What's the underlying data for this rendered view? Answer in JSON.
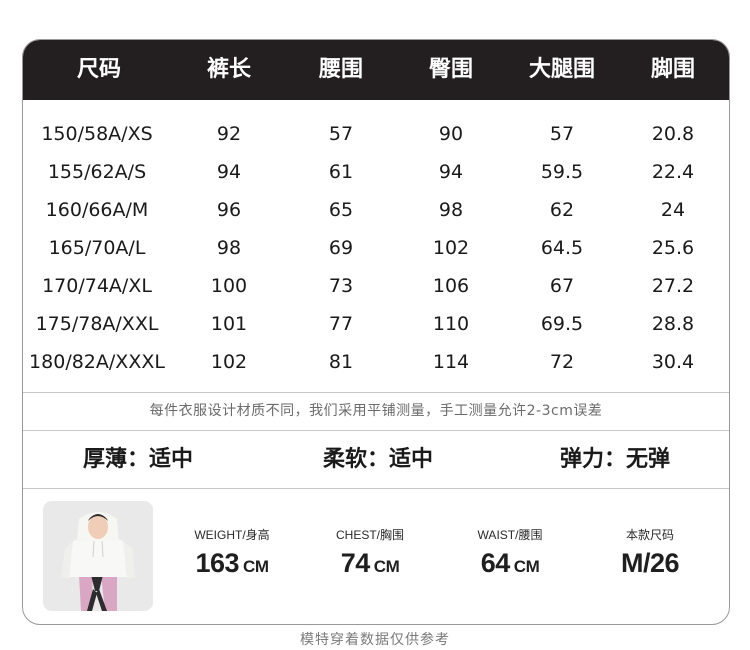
{
  "table": {
    "headers": [
      "尺码",
      "裤长",
      "腰围",
      "臀围",
      "大腿围",
      "脚围"
    ],
    "rows": [
      [
        "150/58A/XS",
        "92",
        "57",
        "90",
        "57",
        "20.8"
      ],
      [
        "155/62A/S",
        "94",
        "61",
        "94",
        "59.5",
        "22.4"
      ],
      [
        "160/66A/M",
        "96",
        "65",
        "98",
        "62",
        "24"
      ],
      [
        "165/70A/L",
        "98",
        "69",
        "102",
        "64.5",
        "25.6"
      ],
      [
        "170/74A/XL",
        "100",
        "73",
        "106",
        "67",
        "27.2"
      ],
      [
        "175/78A/XXL",
        "101",
        "77",
        "110",
        "69.5",
        "28.8"
      ],
      [
        "180/82A/XXXL",
        "102",
        "81",
        "114",
        "72",
        "30.4"
      ]
    ]
  },
  "note": "每件衣服设计材质不同，我们采用平铺测量，手工测量允许2-3cm误差",
  "features": [
    {
      "label": "厚薄：适中"
    },
    {
      "label": "柔软：适中"
    },
    {
      "label": "弹力：无弹"
    }
  ],
  "model": {
    "stats": [
      {
        "label": "WEIGHT/身高",
        "value": "163",
        "unit": "CM"
      },
      {
        "label": "CHEST/胸围",
        "value": "74",
        "unit": "CM"
      },
      {
        "label": "WAIST/腰围",
        "value": "64",
        "unit": "CM"
      },
      {
        "label": "本款尺码",
        "value": "M/26",
        "unit": ""
      }
    ]
  },
  "footer": "模特穿着数据仅供参考",
  "colors": {
    "header_bg": "#231f20",
    "header_text": "#ffffff",
    "body_text": "#1a1a1a",
    "muted_text": "#6b6b6b",
    "border": "#9a9a9a",
    "photo_bg": "#e9e9ea"
  }
}
